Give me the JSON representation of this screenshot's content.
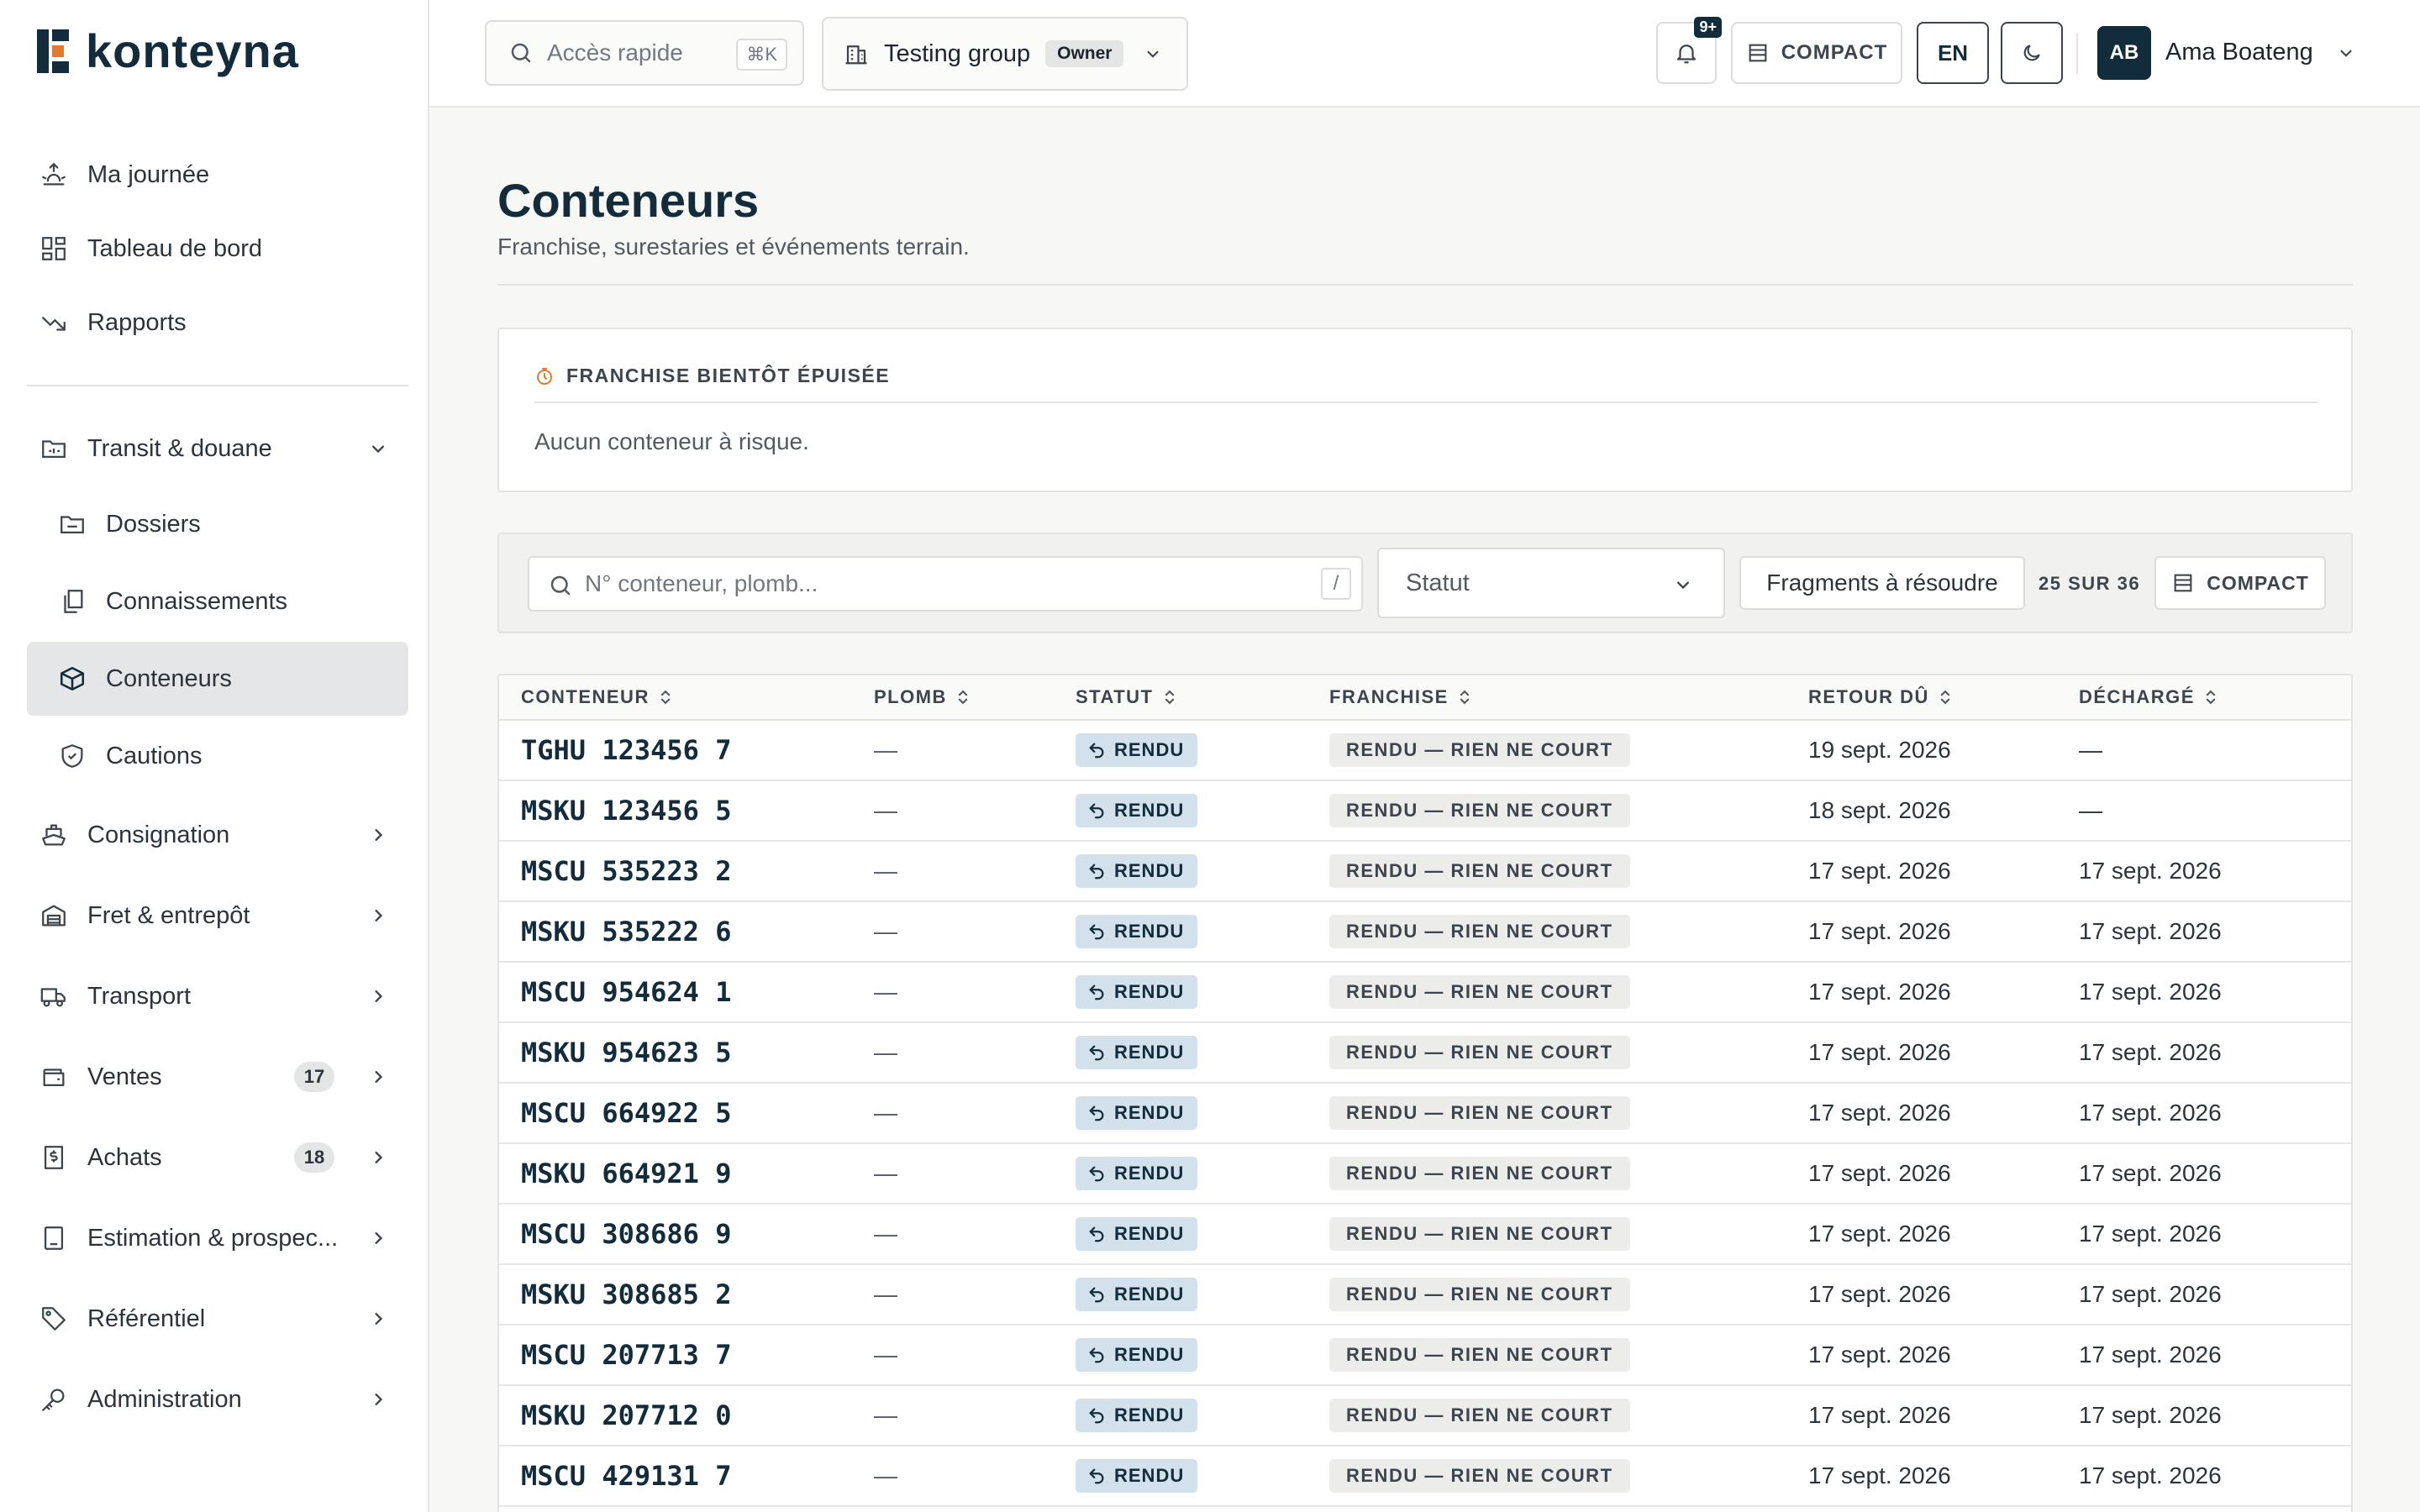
{
  "brand": {
    "name": "konteyna"
  },
  "sidebar": {
    "top_items": [
      {
        "label": "Ma journée",
        "icon": "sunrise-icon"
      },
      {
        "label": "Tableau de bord",
        "icon": "dashboard-grid-icon"
      },
      {
        "label": "Rapports",
        "icon": "trend-down-icon"
      }
    ],
    "transit": {
      "label": "Transit & douane",
      "icon": "folder-customs-icon"
    },
    "transit_sub": [
      {
        "label": "Dossiers",
        "icon": "folder-icon"
      },
      {
        "label": "Connaissements",
        "icon": "documents-icon"
      },
      {
        "label": "Conteneurs",
        "icon": "box-icon"
      },
      {
        "label": "Cautions",
        "icon": "shield-icon"
      }
    ],
    "groups": [
      {
        "label": "Consignation",
        "icon": "ship-icon"
      },
      {
        "label": "Fret & entrepôt",
        "icon": "warehouse-icon"
      },
      {
        "label": "Transport",
        "icon": "truck-icon"
      },
      {
        "label": "Ventes",
        "icon": "wallet-icon",
        "badge": "17"
      },
      {
        "label": "Achats",
        "icon": "dollar-receipt-icon",
        "badge": "18"
      },
      {
        "label": "Estimation & prospec...",
        "icon": "calculator-icon"
      },
      {
        "label": "Référentiel",
        "icon": "tag-icon"
      },
      {
        "label": "Administration",
        "icon": "key-icon"
      }
    ]
  },
  "header": {
    "quick_search": {
      "placeholder": "Accès rapide",
      "shortcut": "⌘K"
    },
    "group": {
      "name": "Testing group",
      "role": "Owner"
    },
    "notifications_badge": "9+",
    "compact_label": "COMPACT",
    "language": "EN",
    "user": {
      "initials": "AB",
      "name": "Ama Boateng"
    }
  },
  "page": {
    "title": "Conteneurs",
    "subtitle": "Franchise, surestaries et événements terrain."
  },
  "alert": {
    "heading": "FRANCHISE BIENTÔT ÉPUISÉE",
    "message": "Aucun conteneur à risque."
  },
  "filters": {
    "search_placeholder": "N° conteneur, plomb...",
    "search_shortcut": "/",
    "status_label": "Statut",
    "fragments_label": "Fragments à résoudre",
    "count_label": "25 SUR 36",
    "compact_label": "COMPACT"
  },
  "table": {
    "columns": [
      "CONTENEUR",
      "PLOMB",
      "STATUT",
      "FRANCHISE",
      "RETOUR DÛ",
      "DÉCHARGÉ"
    ],
    "rows": [
      {
        "container": "TGHU 123456 7",
        "seal": "—",
        "status": "RENDU",
        "franchise": "RENDU — RIEN NE COURT",
        "return_due": "19 sept. 2026",
        "discharged": "—"
      },
      {
        "container": "MSKU 123456 5",
        "seal": "—",
        "status": "RENDU",
        "franchise": "RENDU — RIEN NE COURT",
        "return_due": "18 sept. 2026",
        "discharged": "—"
      },
      {
        "container": "MSCU 535223 2",
        "seal": "—",
        "status": "RENDU",
        "franchise": "RENDU — RIEN NE COURT",
        "return_due": "17 sept. 2026",
        "discharged": "17 sept. 2026"
      },
      {
        "container": "MSKU 535222 6",
        "seal": "—",
        "status": "RENDU",
        "franchise": "RENDU — RIEN NE COURT",
        "return_due": "17 sept. 2026",
        "discharged": "17 sept. 2026"
      },
      {
        "container": "MSCU 954624 1",
        "seal": "—",
        "status": "RENDU",
        "franchise": "RENDU — RIEN NE COURT",
        "return_due": "17 sept. 2026",
        "discharged": "17 sept. 2026"
      },
      {
        "container": "MSKU 954623 5",
        "seal": "—",
        "status": "RENDU",
        "franchise": "RENDU — RIEN NE COURT",
        "return_due": "17 sept. 2026",
        "discharged": "17 sept. 2026"
      },
      {
        "container": "MSCU 664922 5",
        "seal": "—",
        "status": "RENDU",
        "franchise": "RENDU — RIEN NE COURT",
        "return_due": "17 sept. 2026",
        "discharged": "17 sept. 2026"
      },
      {
        "container": "MSKU 664921 9",
        "seal": "—",
        "status": "RENDU",
        "franchise": "RENDU — RIEN NE COURT",
        "return_due": "17 sept. 2026",
        "discharged": "17 sept. 2026"
      },
      {
        "container": "MSCU 308686 9",
        "seal": "—",
        "status": "RENDU",
        "franchise": "RENDU — RIEN NE COURT",
        "return_due": "17 sept. 2026",
        "discharged": "17 sept. 2026"
      },
      {
        "container": "MSKU 308685 2",
        "seal": "—",
        "status": "RENDU",
        "franchise": "RENDU — RIEN NE COURT",
        "return_due": "17 sept. 2026",
        "discharged": "17 sept. 2026"
      },
      {
        "container": "MSCU 207713 7",
        "seal": "—",
        "status": "RENDU",
        "franchise": "RENDU — RIEN NE COURT",
        "return_due": "17 sept. 2026",
        "discharged": "17 sept. 2026"
      },
      {
        "container": "MSKU 207712 0",
        "seal": "—",
        "status": "RENDU",
        "franchise": "RENDU — RIEN NE COURT",
        "return_due": "17 sept. 2026",
        "discharged": "17 sept. 2026"
      },
      {
        "container": "MSCU 429131 7",
        "seal": "—",
        "status": "RENDU",
        "franchise": "RENDU — RIEN NE COURT",
        "return_due": "17 sept. 2026",
        "discharged": "17 sept. 2026"
      },
      {
        "container": "",
        "seal": "",
        "status": "",
        "franchise": "",
        "return_due": "",
        "discharged": ""
      }
    ]
  }
}
